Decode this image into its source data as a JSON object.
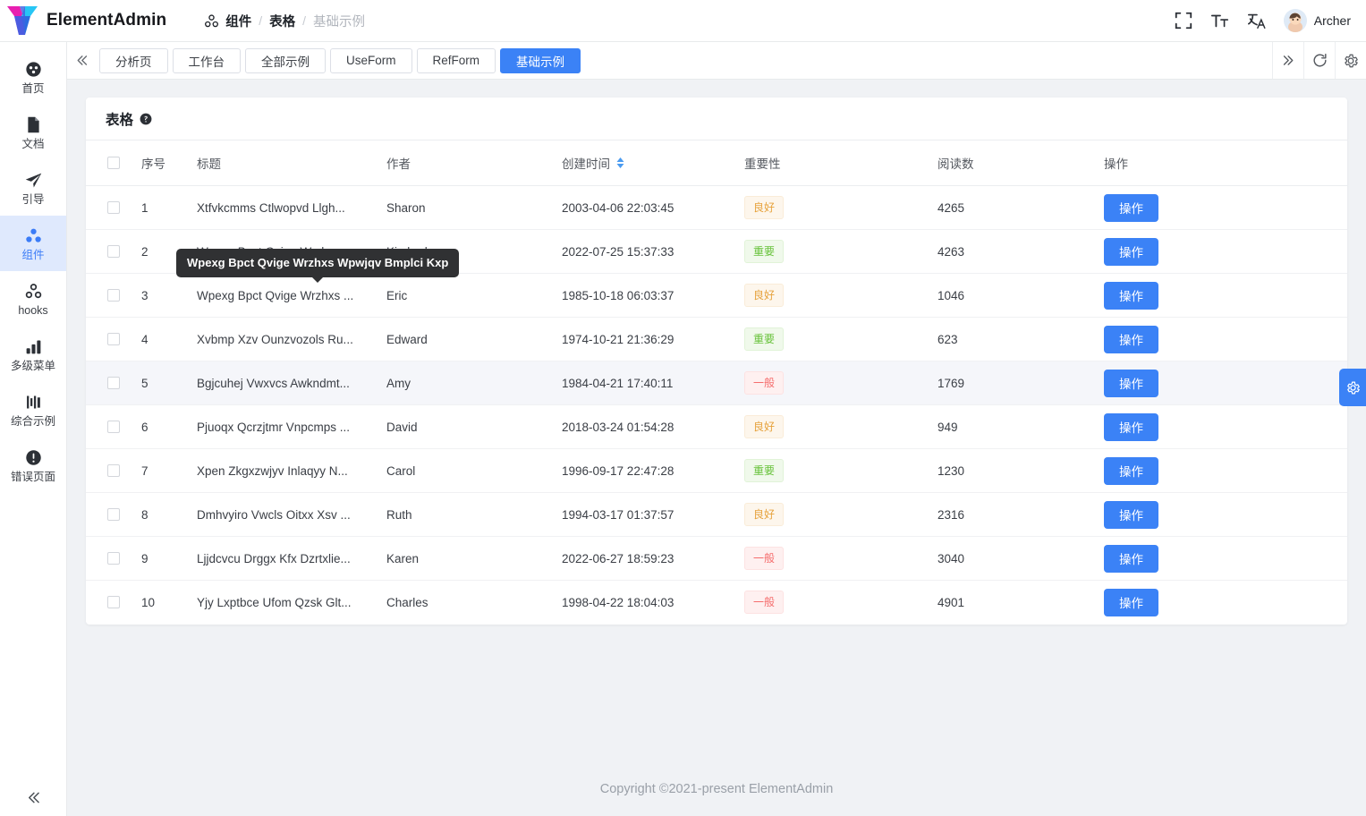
{
  "header": {
    "brand": "ElementAdmin",
    "logo_colors": {
      "left": "#e81fb0",
      "mid": "#3d63e0",
      "right": "#27c6f5"
    },
    "breadcrumb": [
      {
        "label": "组件",
        "muted": false,
        "icon": "components-icon"
      },
      {
        "label": "表格",
        "muted": false
      },
      {
        "label": "基础示例",
        "muted": true
      }
    ],
    "separator": "/",
    "actions": [
      {
        "name": "fullscreen-icon",
        "label": "全屏"
      },
      {
        "name": "font-size-icon",
        "label": "字体大小"
      },
      {
        "name": "language-icon",
        "label": "语言切换"
      }
    ],
    "user": {
      "name": "Archer",
      "avatar": "user-avatar"
    }
  },
  "sidebar": {
    "items": [
      {
        "label": "首页",
        "icon": "dashboard-icon",
        "active": false
      },
      {
        "label": "文档",
        "icon": "document-icon",
        "active": false
      },
      {
        "label": "引导",
        "icon": "guide-icon",
        "active": false
      },
      {
        "label": "组件",
        "icon": "components-icon",
        "active": true
      },
      {
        "label": "hooks",
        "icon": "hooks-icon",
        "active": false
      },
      {
        "label": "多级菜单",
        "icon": "chart-bar-icon",
        "active": false
      },
      {
        "label": "综合示例",
        "icon": "example-icon",
        "active": false
      },
      {
        "label": "错误页面",
        "icon": "error-icon",
        "active": false
      }
    ],
    "collapse": {
      "name": "collapse-sidebar-button",
      "icon": "double-chevron-left-icon"
    },
    "active_color": "#3b7cf7",
    "active_bg": "#dfe9fd"
  },
  "tabbar": {
    "scroll_left": "double-chevron-left-icon",
    "tabs": [
      {
        "label": "分析页",
        "active": false
      },
      {
        "label": "工作台",
        "active": false
      },
      {
        "label": "全部示例",
        "active": false
      },
      {
        "label": "UseForm",
        "active": false
      },
      {
        "label": "RefForm",
        "active": false
      },
      {
        "label": "基础示例",
        "active": true
      }
    ],
    "right_buttons": [
      {
        "name": "tab-more-button",
        "icon": "double-chevron-right-icon"
      },
      {
        "name": "refresh-button",
        "icon": "refresh-icon"
      },
      {
        "name": "tab-settings-button",
        "icon": "gear-icon"
      }
    ],
    "active_color": "#3b82f6"
  },
  "card": {
    "title": "表格",
    "help_icon": "question-mark-icon"
  },
  "table": {
    "columns": [
      {
        "key": "checkbox",
        "label": ""
      },
      {
        "key": "index",
        "label": "序号"
      },
      {
        "key": "title",
        "label": "标题"
      },
      {
        "key": "author",
        "label": "作者"
      },
      {
        "key": "date",
        "label": "创建时间",
        "sortable": true
      },
      {
        "key": "importance",
        "label": "重要性"
      },
      {
        "key": "reads",
        "label": "阅读数"
      },
      {
        "key": "action",
        "label": "操作"
      }
    ],
    "header_checkbox_checked": false,
    "sort_icon": "sort-caret-icon",
    "action_button_label": "操作",
    "rows": [
      {
        "index": "1",
        "title": "Xtfvkcmms Ctlwopvd Llgh...",
        "author": "Sharon",
        "date": "2003-04-06 22:03:45",
        "importance": "良好",
        "tag": "warning",
        "reads": "4265",
        "highlight": false
      },
      {
        "index": "2",
        "title": "Wpexg Bpct Qvige Wrzhxs ...",
        "author": "Kimberly",
        "date": "2022-07-25 15:37:33",
        "importance": "重要",
        "tag": "success",
        "reads": "4263",
        "highlight": false
      },
      {
        "index": "3",
        "title": "Wpexg Bpct Qvige Wrzhxs ...",
        "author": "Eric",
        "date": "1985-10-18 06:03:37",
        "importance": "良好",
        "tag": "warning",
        "reads": "1046",
        "highlight": false
      },
      {
        "index": "4",
        "title": "Xvbmp Xzv Ounzvozols Ru...",
        "author": "Edward",
        "date": "1974-10-21 21:36:29",
        "importance": "重要",
        "tag": "success",
        "reads": "623",
        "highlight": false
      },
      {
        "index": "5",
        "title": "Bgjcuhej Vwxvcs Awkndmt...",
        "author": "Amy",
        "date": "1984-04-21 17:40:11",
        "importance": "一般",
        "tag": "danger",
        "reads": "1769",
        "highlight": true
      },
      {
        "index": "6",
        "title": "Pjuoqx Qcrzjtmr Vnpcmps ...",
        "author": "David",
        "date": "2018-03-24 01:54:28",
        "importance": "良好",
        "tag": "warning",
        "reads": "949",
        "highlight": false
      },
      {
        "index": "7",
        "title": "Xpen Zkgxzwjyv Inlaqyy N...",
        "author": "Carol",
        "date": "1996-09-17 22:47:28",
        "importance": "重要",
        "tag": "success",
        "reads": "1230",
        "highlight": false
      },
      {
        "index": "8",
        "title": "Dmhvyiro Vwcls Oitxx Xsv ...",
        "author": "Ruth",
        "date": "1994-03-17 01:37:57",
        "importance": "良好",
        "tag": "warning",
        "reads": "2316",
        "highlight": false
      },
      {
        "index": "9",
        "title": "Ljjdcvcu Drggx Kfx Dzrtxlie...",
        "author": "Karen",
        "date": "2022-06-27 18:59:23",
        "importance": "一般",
        "tag": "danger",
        "reads": "3040",
        "highlight": false
      },
      {
        "index": "10",
        "title": "Yjy Lxptbce Ufom Qzsk Glt...",
        "author": "Charles",
        "date": "1998-04-22 18:04:03",
        "importance": "一般",
        "tag": "danger",
        "reads": "4901",
        "highlight": false
      }
    ]
  },
  "tooltip": {
    "text": "Wpexg Bpct Qvige Wrzhxs Wpwjqv Bmplci Kxp",
    "background": "#303133"
  },
  "float_setting": {
    "icon": "gear-icon",
    "color": "#3b82f6"
  },
  "footer": {
    "text": "Copyright ©2021-present ElementAdmin"
  },
  "colors": {
    "accent": "#3b82f6",
    "tag_warning": "#e6a23c",
    "tag_success": "#67c23a",
    "tag_danger": "#f56c6c",
    "page_bg": "#f0f2f5"
  }
}
